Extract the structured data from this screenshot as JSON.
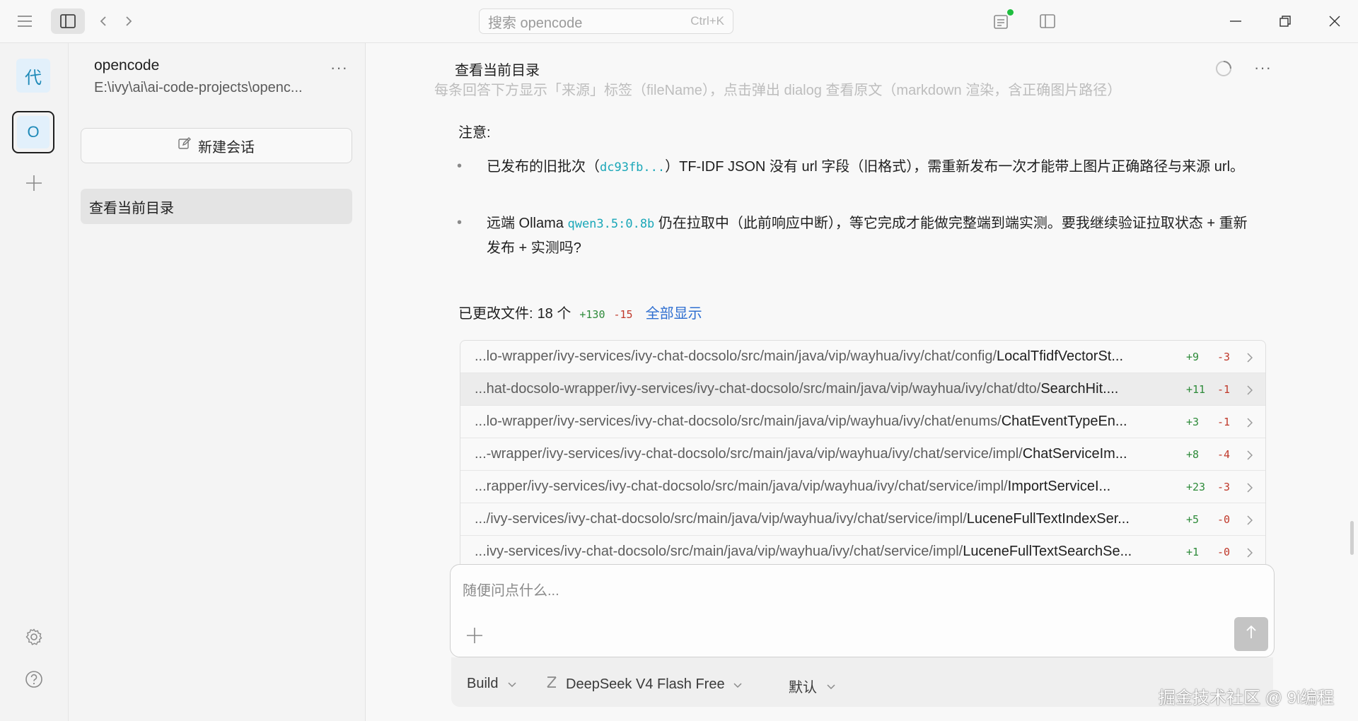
{
  "titlebar": {
    "search_placeholder": "搜索 opencode",
    "search_shortcut": "Ctrl+K",
    "icons": [
      "menu-icon",
      "sidebar-toggle-icon",
      "back-icon",
      "forward-icon",
      "review-icon",
      "right-panel-icon",
      "minimize-icon",
      "maximize-icon",
      "close-icon"
    ],
    "status_dot_color": "#1fbe3f"
  },
  "rail": {
    "workspaces": [
      {
        "label": "代",
        "selected": false
      },
      {
        "label": "O",
        "selected": true
      }
    ]
  },
  "project": {
    "name": "opencode",
    "path": "E:\\ivy\\ai\\ai-code-projects\\openc...",
    "new_session_label": "新建会话",
    "sessions": [
      "查看当前目录"
    ]
  },
  "conversation": {
    "title": "查看当前目录",
    "clipped_line": "每条回答下方显示「来源」标签（fileName），点击弹出 dialog 查看原文（markdown 渲染，含正确图片路径）",
    "note_label": "注意:",
    "bullets": [
      {
        "before": "已发布的旧批次（",
        "code": "dc93fb...",
        "after": "）TF-IDF JSON 没有 url 字段（旧格式），需重新发布一次才能带上图片正确路径与来源 url。"
      },
      {
        "before": "远端 Ollama ",
        "code": "qwen3.5:0.8b",
        "after": " 仍在拉取中（此前响应中断），等它完成才能做完整端到端实测。要我继续验证拉取状态 + 重新发布 + 实测吗?"
      }
    ],
    "changed_files_label": "已更改文件:",
    "changed_files_count": "18 个",
    "total_added": "+130",
    "total_removed": "-15",
    "show_all_label": "全部显示",
    "files": [
      {
        "dir": "...lo-wrapper/ivy-services/ivy-chat-docsolo/src/main/java/vip/wayhua/ivy/chat/config/",
        "name": "LocalTfidfVectorSt...",
        "added": "+9",
        "removed": "-3",
        "highlighted": false
      },
      {
        "dir": "...hat-docsolo-wrapper/ivy-services/ivy-chat-docsolo/src/main/java/vip/wayhua/ivy/chat/dto/",
        "name": "SearchHit....",
        "added": "+11",
        "removed": "-1",
        "highlighted": true
      },
      {
        "dir": "...lo-wrapper/ivy-services/ivy-chat-docsolo/src/main/java/vip/wayhua/ivy/chat/enums/",
        "name": "ChatEventTypeEn...",
        "added": "+3",
        "removed": "-1",
        "highlighted": false
      },
      {
        "dir": "...-wrapper/ivy-services/ivy-chat-docsolo/src/main/java/vip/wayhua/ivy/chat/service/impl/",
        "name": "ChatServiceIm...",
        "added": "+8",
        "removed": "-4",
        "highlighted": false
      },
      {
        "dir": "...rapper/ivy-services/ivy-chat-docsolo/src/main/java/vip/wayhua/ivy/chat/service/impl/",
        "name": "ImportServiceI...",
        "added": "+23",
        "removed": "-3",
        "highlighted": false
      },
      {
        "dir": ".../ivy-services/ivy-chat-docsolo/src/main/java/vip/wayhua/ivy/chat/service/impl/",
        "name": "LuceneFullTextIndexSer...",
        "added": "+5",
        "removed": "-0",
        "highlighted": false
      },
      {
        "dir": "...ivy-services/ivy-chat-docsolo/src/main/java/vip/wayhua/ivy/chat/service/impl/",
        "name": "LuceneFullTextSearchSe...",
        "added": "+1",
        "removed": "-0",
        "highlighted": false
      }
    ]
  },
  "composer": {
    "placeholder": "随便问点什么...",
    "agent_label": "Build",
    "model_label": "DeepSeek V4 Flash Free",
    "variant_label": "默认"
  },
  "watermark": "掘金技术社区 @ 9i编程"
}
